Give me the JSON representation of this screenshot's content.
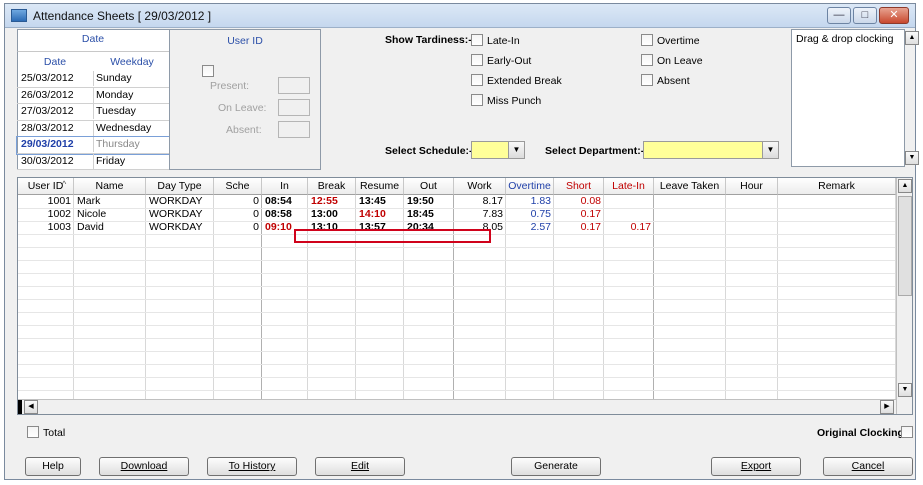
{
  "window": {
    "title": "Attendance Sheets  [ 29/03/2012 ]"
  },
  "date_list": {
    "group_label": "Date",
    "col_date": "Date",
    "col_weekday": "Weekday",
    "rows": [
      {
        "date": "25/03/2012",
        "weekday": "Sunday"
      },
      {
        "date": "26/03/2012",
        "weekday": "Monday"
      },
      {
        "date": "27/03/2012",
        "weekday": "Tuesday"
      },
      {
        "date": "28/03/2012",
        "weekday": "Wednesday"
      },
      {
        "date": "29/03/2012",
        "weekday": "Thursday"
      },
      {
        "date": "30/03/2012",
        "weekday": "Friday"
      }
    ],
    "selected_index": 4
  },
  "user_panel": {
    "header": "User ID",
    "present_label": "Present:",
    "on_leave_label": "On Leave:",
    "absent_label": "Absent:"
  },
  "tardiness": {
    "label": "Show Tardiness:-",
    "options": [
      "Late-In",
      "Early-Out",
      "Extended Break",
      "Miss Punch",
      "Overtime",
      "On Leave",
      "Absent"
    ]
  },
  "filters": {
    "schedule_label": "Select Schedule:-",
    "department_label": "Select Department:-"
  },
  "dragdrop": {
    "label": "Drag & drop clocking"
  },
  "table": {
    "headers": [
      "User ID",
      "Name",
      "Day Type",
      "Sche",
      "In",
      "Break",
      "Resume",
      "Out",
      "Work",
      "Overtime",
      "Short",
      "Late-In",
      "Leave Taken",
      "Hour",
      "Remark"
    ],
    "sort_indicator": "^",
    "rows": [
      {
        "user_id": "1001",
        "name": "Mark",
        "day_type": "WORKDAY",
        "sche": "0",
        "in": "08:54",
        "break": "12:55",
        "resume": "13:45",
        "out": "19:50",
        "work": "8.17",
        "overtime": "1.83",
        "short": "0.08",
        "late_in": ""
      },
      {
        "user_id": "1002",
        "name": "Nicole",
        "day_type": "WORKDAY",
        "sche": "0",
        "in": "08:58",
        "break": "13:00",
        "resume": "14:10",
        "out": "18:45",
        "work": "7.83",
        "overtime": "0.75",
        "short": "0.17",
        "late_in": ""
      },
      {
        "user_id": "1003",
        "name": "David",
        "day_type": "WORKDAY",
        "sche": "0",
        "in": "09:10",
        "break": "13:10",
        "resume": "13:57",
        "out": "20:34",
        "work": "8.05",
        "overtime": "2.57",
        "short": "0.17",
        "late_in": "0.17"
      }
    ]
  },
  "footer": {
    "total_label": "Total",
    "original_clocking_label": "Original Clocking"
  },
  "buttons": {
    "help": "Help",
    "download": "Download",
    "to_history": "To History",
    "edit": "Edit",
    "generate": "Generate",
    "export": "Export",
    "cancel": "Cancel"
  },
  "colors": {
    "late_red": "#c00000",
    "overtime_blue": "#1f3fa8",
    "highlight_box": "#d0021b",
    "combo_yellow": "#ffff99",
    "selected_date": "#1f3fa8"
  }
}
